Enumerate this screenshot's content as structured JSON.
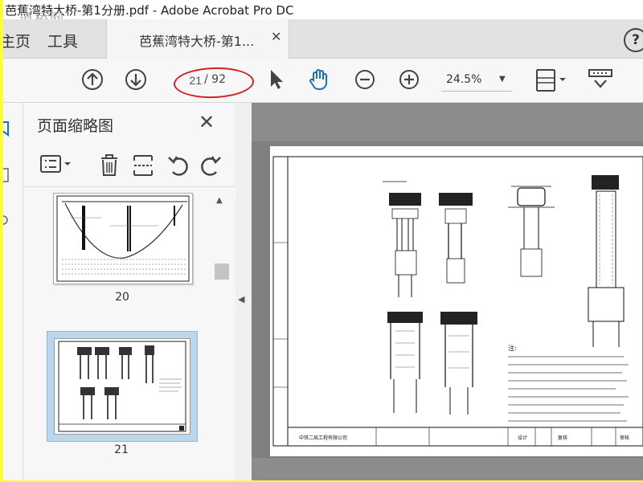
{
  "window": {
    "title": "芭蕉湾特大桥-第1分册.pdf - Adobe Acrobat Pro DC",
    "watermark": "道桥网"
  },
  "tabs": {
    "home": "主页",
    "tools": "工具",
    "document": "芭蕉湾特大桥-第1..."
  },
  "toolbar": {
    "current_page": "21",
    "total_pages": "/ 92",
    "zoom": "24.5%"
  },
  "thumbnail_panel": {
    "title": "页面缩略图",
    "thumbnails": [
      {
        "page": "20"
      },
      {
        "page": "21",
        "selected": true
      }
    ]
  },
  "drawing": {
    "notes_heading": "注:",
    "company": "中铁二局工程有限公司",
    "sign_design": "设计",
    "sign_review": "复核",
    "sign_audit": "审核",
    "colors": {
      "highlight": "#bcd7ec",
      "annotation": "#d42020",
      "background": "#ffff33"
    }
  }
}
